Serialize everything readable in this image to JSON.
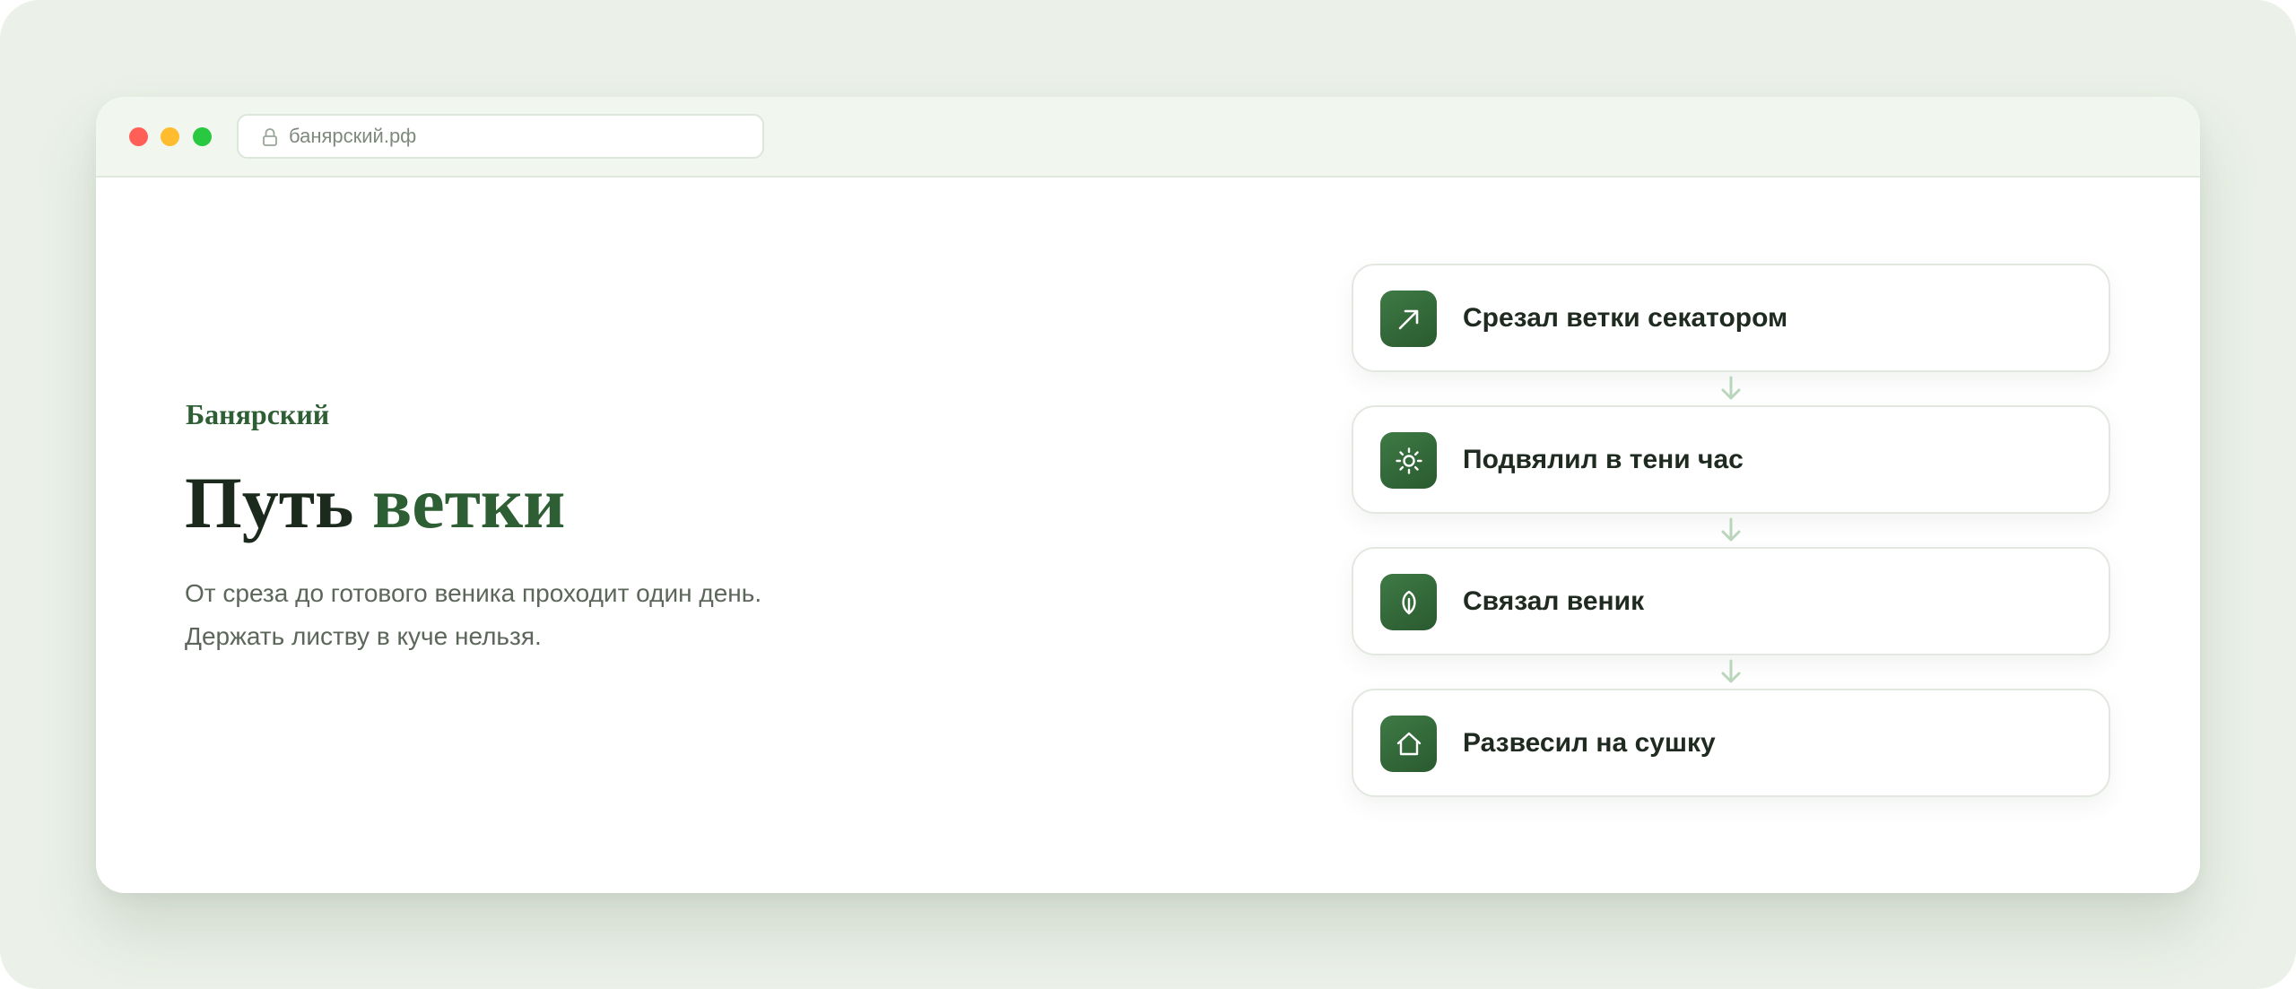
{
  "browser": {
    "url": "банярский.рф"
  },
  "hero": {
    "brand": "Банярский",
    "title_part1": "Путь",
    "title_part2": "ветки",
    "lead_line1": "От среза до готового веника проходит один день.",
    "lead_line2": "Держать листву в куче нельзя."
  },
  "steps": [
    {
      "label": "Срезал ветки секатором",
      "icon": "arrow-up-right-icon"
    },
    {
      "label": "Подвялил в тени час",
      "icon": "sun-icon"
    },
    {
      "label": "Связал веник",
      "icon": "leaf-icon"
    },
    {
      "label": "Развесил на сушку",
      "icon": "house-icon"
    }
  ],
  "colors": {
    "accent": "#2e5e33",
    "background": "#ebf1e8",
    "connector": "#b9d6bc"
  }
}
